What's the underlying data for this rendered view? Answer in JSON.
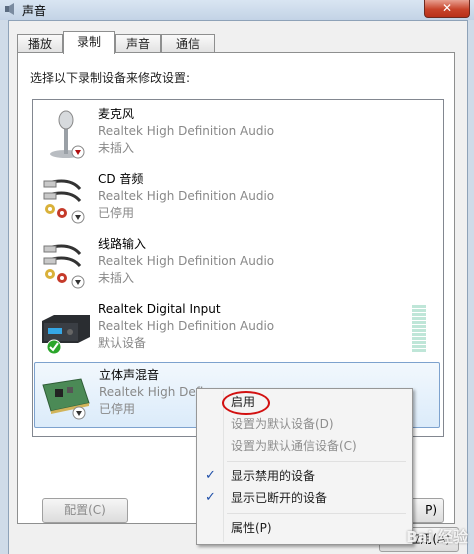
{
  "window": {
    "title": "声音",
    "close_label": "✕"
  },
  "tabs": [
    "播放",
    "录制",
    "声音",
    "通信"
  ],
  "instruction": "选择以下录制设备来修改设置:",
  "devices": [
    {
      "name": "麦克风",
      "driver": "Realtek High Definition Audio",
      "status": "未插入",
      "icon": "microphone-icon",
      "badge": "down-arrow"
    },
    {
      "name": "CD 音频",
      "driver": "Realtek High Definition Audio",
      "status": "已停用",
      "icon": "rca-cable-icon",
      "badge": "down-arrow"
    },
    {
      "name": "线路输入",
      "driver": "Realtek High Definition Audio",
      "status": "未插入",
      "icon": "rca-cable-icon",
      "badge": "down-arrow"
    },
    {
      "name": "Realtek Digital Input",
      "driver": "Realtek High Definition Audio",
      "status": "默认设备",
      "icon": "digital-receiver-icon",
      "badge": "check"
    },
    {
      "name": "立体声混音",
      "driver": "Realtek High Defi",
      "status": "已停用",
      "icon": "sound-card-icon",
      "badge": "down-arrow"
    }
  ],
  "buttons": {
    "configure": "配置(C)",
    "properties_fragment": "P)",
    "apply_fragment": "应用(A)"
  },
  "context_menu": [
    {
      "label": "启用",
      "disabled": false,
      "checked": false
    },
    {
      "label": "设置为默认设备(D)",
      "disabled": true,
      "checked": false
    },
    {
      "label": "设置为默认通信设备(C)",
      "disabled": true,
      "checked": false
    },
    {
      "label": "显示禁用的设备",
      "disabled": false,
      "checked": true
    },
    {
      "label": "显示已断开的设备",
      "disabled": false,
      "checked": true
    },
    {
      "label": "属性(P)",
      "disabled": false,
      "checked": false
    }
  ],
  "watermark": "Bai 经验",
  "colors": {
    "selection": "#dbebfa",
    "highlight_circle": "#d21010",
    "default_check": "#2aa52a",
    "disabled_arrow": "#b01010"
  }
}
